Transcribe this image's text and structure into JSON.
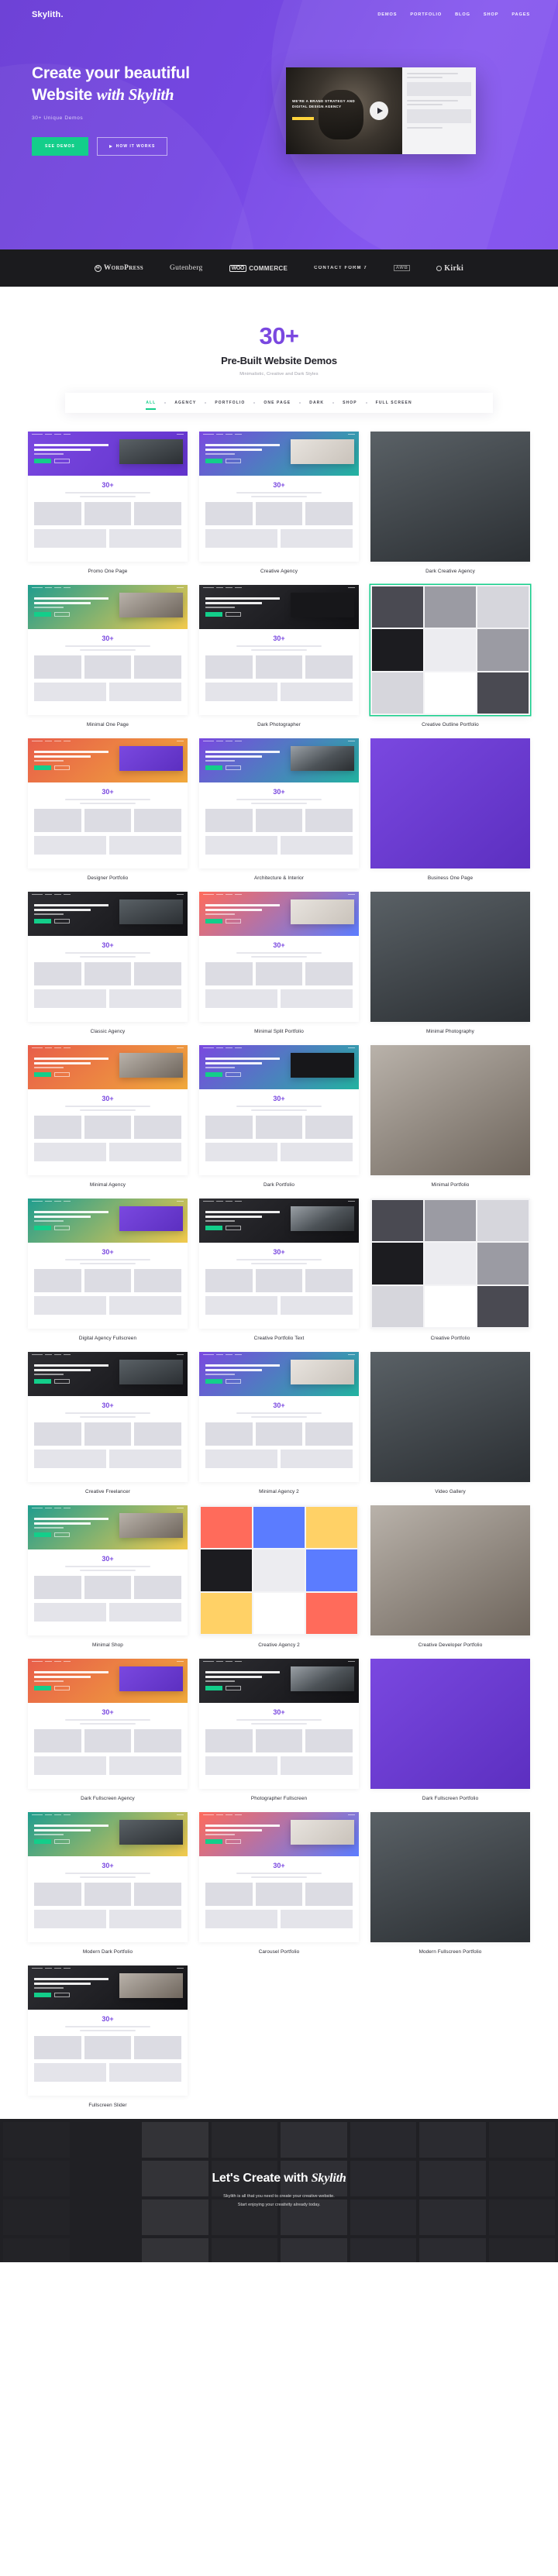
{
  "header": {
    "brand": "Skylith.",
    "nav": [
      {
        "label": "DEMOS"
      },
      {
        "label": "PORTFOLIO"
      },
      {
        "label": "BLOG"
      },
      {
        "label": "SHOP"
      },
      {
        "label": "PAGES"
      }
    ]
  },
  "hero": {
    "title_line1": "Create your beautiful",
    "title_line2_plain": "Website ",
    "title_line2_script": "with Skylith",
    "subtitle": "30+ Unique Demos",
    "btn_primary": "SEE DEMOS",
    "btn_secondary": "HOW IT WORKS",
    "video_kicker": "WE'RE A BRAND STRATEGY AND DIGITAL DESIGN AGENCY",
    "accent_color": "#13ce8a",
    "bg_color": "#7547e2"
  },
  "brands": [
    {
      "name": "WordPress"
    },
    {
      "name": "Gutenberg"
    },
    {
      "name": "WOO COMMERCE"
    },
    {
      "name": "CONTACT FORM 7"
    },
    {
      "name": "AWB"
    },
    {
      "name": "Kirki"
    }
  ],
  "demos_section": {
    "count": "30+",
    "title": "Pre-Built Website Demos",
    "subtitle": "Minimalistic, Creative and Dark Styles",
    "filters": [
      {
        "label": "ALL",
        "active": true
      },
      {
        "label": "AGENCY",
        "active": false
      },
      {
        "label": "PORTFOLIO",
        "active": false
      },
      {
        "label": "ONE PAGE",
        "active": false
      },
      {
        "label": "DARK",
        "active": false
      },
      {
        "label": "SHOP",
        "active": false
      },
      {
        "label": "FULL SCREEN",
        "active": false
      }
    ],
    "cards": [
      {
        "label": "Promo One Page"
      },
      {
        "label": "Creative Agency"
      },
      {
        "label": "Dark Creative Agency"
      },
      {
        "label": "Minimal One Page"
      },
      {
        "label": "Dark Photographer"
      },
      {
        "label": "Creative Outline Portfolio"
      },
      {
        "label": "Designer Portfolio"
      },
      {
        "label": "Architecture & Interior"
      },
      {
        "label": "Business One Page"
      },
      {
        "label": "Classic Agency"
      },
      {
        "label": "Minimal Split Portfolio"
      },
      {
        "label": "Minimal Photography"
      },
      {
        "label": "Minimal Agency"
      },
      {
        "label": "Dark Portfolio"
      },
      {
        "label": "Minimal Portfolio"
      },
      {
        "label": "Digital Agency Fullscreen"
      },
      {
        "label": "Creative Portfolio Text"
      },
      {
        "label": "Creative Portfolio"
      },
      {
        "label": "Creative Freelancer"
      },
      {
        "label": "Minimal Agency 2"
      },
      {
        "label": "Video Gallery"
      },
      {
        "label": "Minimal Shop"
      },
      {
        "label": "Creative Agency 2"
      },
      {
        "label": "Creative Developer Portfolio"
      },
      {
        "label": "Dark Fullscreen Agency"
      },
      {
        "label": "Photographer Fullscreen"
      },
      {
        "label": "Dark Fullscreen Portfolio"
      },
      {
        "label": "Modern Dark Portfolio"
      },
      {
        "label": "Carousel Portfolio"
      },
      {
        "label": "Modern Fullscreen Portfolio"
      },
      {
        "label": "Fullscreen Slider"
      }
    ]
  },
  "cta": {
    "title_plain": "Let's Create with ",
    "title_script": "Skylith",
    "line1": "Skylith is all that you need to create your creative website.",
    "line2": "Start enjoying your creativity already today."
  }
}
